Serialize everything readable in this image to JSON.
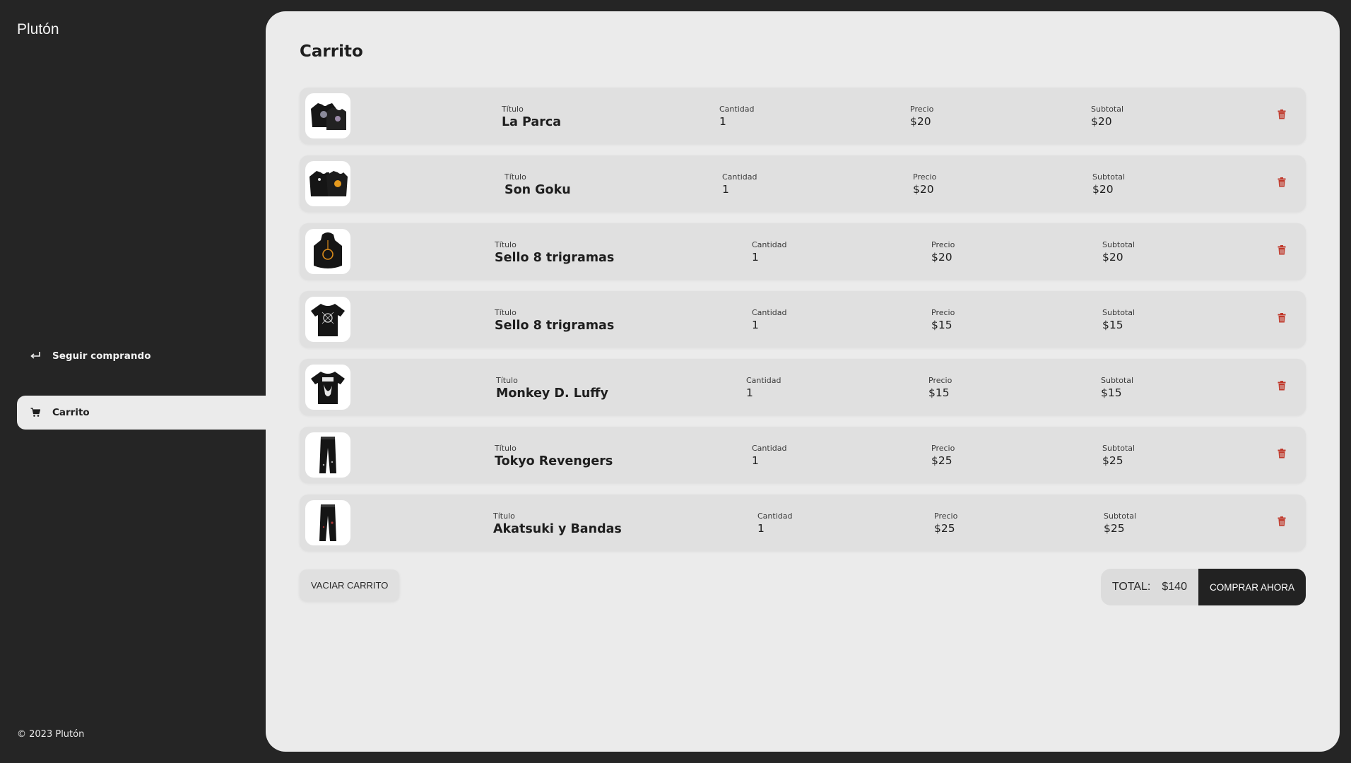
{
  "app": {
    "brand": "Plutón",
    "copyright": "© 2023 Plutón"
  },
  "sidebar": {
    "items": [
      {
        "label": "Seguir comprando",
        "icon": "return-arrow-icon"
      },
      {
        "label": "Carrito",
        "icon": "cart-icon"
      }
    ]
  },
  "page": {
    "title": "Carrito"
  },
  "labels": {
    "title": "Título",
    "quantity": "Cantidad",
    "price": "Precio",
    "subtotal": "Subtotal"
  },
  "cart": {
    "items": [
      {
        "title": "La Parca",
        "quantity": "1",
        "price": "$20",
        "subtotal": "$20",
        "image": "hoodie-set-icon"
      },
      {
        "title": "Son Goku",
        "quantity": "1",
        "price": "$20",
        "subtotal": "$20",
        "image": "hoodie-set-icon"
      },
      {
        "title": "Sello 8 trigramas",
        "quantity": "1",
        "price": "$20",
        "subtotal": "$20",
        "image": "hoodie-icon"
      },
      {
        "title": "Sello 8 trigramas",
        "quantity": "1",
        "price": "$15",
        "subtotal": "$15",
        "image": "tshirt-icon"
      },
      {
        "title": "Monkey D. Luffy",
        "quantity": "1",
        "price": "$15",
        "subtotal": "$15",
        "image": "tshirt-icon"
      },
      {
        "title": "Tokyo Revengers",
        "quantity": "1",
        "price": "$25",
        "subtotal": "$25",
        "image": "pants-icon"
      },
      {
        "title": "Akatsuki y Bandas",
        "quantity": "1",
        "price": "$25",
        "subtotal": "$25",
        "image": "pants-icon"
      }
    ]
  },
  "actions": {
    "empty_cart": "VACIAR CARRITO",
    "total_label": "TOTAL:",
    "total_value": "$140",
    "buy_now": "COMPRAR AHORA"
  },
  "colors": {
    "background": "#252525",
    "panel": "#ebebeb",
    "row": "#e0e0e0",
    "trash": "#c0392b",
    "buy_button": "#222222"
  }
}
